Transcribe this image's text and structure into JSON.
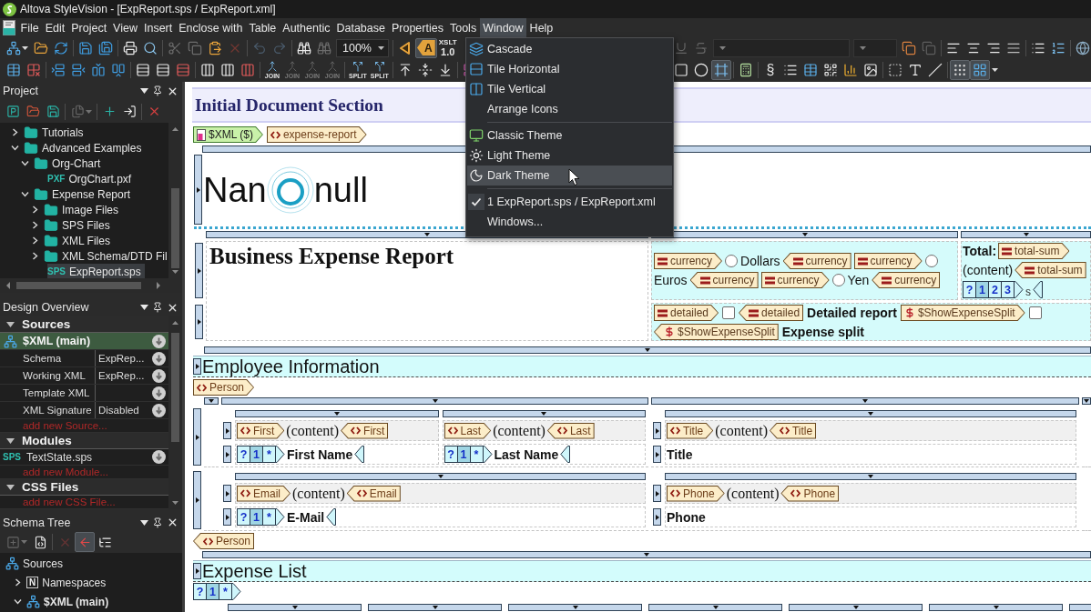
{
  "window": {
    "title": "Altova StyleVision - [ExpReport.sps / ExpReport.xml]"
  },
  "menu_bar": [
    {
      "label": "File",
      "selected": false
    },
    {
      "label": "Edit",
      "selected": false
    },
    {
      "label": "Project",
      "selected": false
    },
    {
      "label": "View",
      "selected": false
    },
    {
      "label": "Insert",
      "selected": false
    },
    {
      "label": "Enclose with",
      "selected": false
    },
    {
      "label": "Table",
      "selected": false
    },
    {
      "label": "Authentic",
      "selected": false
    },
    {
      "label": "Database",
      "selected": false
    },
    {
      "label": "Properties",
      "selected": false
    },
    {
      "label": "Tools",
      "selected": false
    },
    {
      "label": "Window",
      "selected": true
    },
    {
      "label": "Help",
      "selected": false
    }
  ],
  "toolbars": [
    {
      "left": [
        [
          {
            "kind": "dropdown",
            "disabled": false,
            "pressed": false
          },
          {
            "kind": "button",
            "disabled": false,
            "pressed": false
          },
          {
            "kind": "button",
            "disabled": false,
            "pressed": false
          }
        ],
        [
          {
            "kind": "button",
            "disabled": false,
            "pressed": false
          },
          {
            "kind": "button",
            "disabled": false,
            "pressed": false
          }
        ],
        [
          {
            "kind": "button",
            "disabled": false,
            "pressed": false
          },
          {
            "kind": "button",
            "disabled": false,
            "pressed": false
          }
        ],
        [
          {
            "kind": "button",
            "disabled": true,
            "pressed": false
          },
          {
            "kind": "button",
            "disabled": true,
            "pressed": false
          },
          {
            "kind": "button",
            "disabled": false,
            "pressed": false
          },
          {
            "kind": "button",
            "disabled": true,
            "pressed": false
          }
        ],
        [
          {
            "kind": "button",
            "disabled": true,
            "pressed": false
          },
          {
            "kind": "button",
            "disabled": true,
            "pressed": false
          }
        ],
        [
          {
            "kind": "button",
            "disabled": false,
            "pressed": false
          },
          {
            "kind": "button",
            "disabled": true,
            "pressed": false
          },
          {
            "kind": "combo",
            "value": "100%",
            "disabled": false,
            "pressed": false
          }
        ],
        [
          {
            "kind": "button",
            "disabled": false,
            "pressed": false
          },
          {
            "kind": "tag",
            "label": "A",
            "disabled": false,
            "pressed": true
          },
          {
            "kind": "stack",
            "lines": [
              "XSLT",
              "1.0"
            ],
            "disabled": false,
            "pressed": false
          }
        ]
      ],
      "right": [
        [
          {
            "kind": "button",
            "disabled": true,
            "pressed": false
          },
          {
            "kind": "button",
            "disabled": true,
            "pressed": false
          },
          {
            "kind": "combo",
            "disabled": true,
            "pressed": false
          },
          {
            "kind": "combo",
            "disabled": true,
            "pressed": false
          },
          {
            "kind": "button",
            "disabled": false,
            "pressed": false
          },
          {
            "kind": "button",
            "disabled": true,
            "pressed": false
          }
        ],
        [
          {
            "kind": "button",
            "disabled": false,
            "pressed": false
          },
          {
            "kind": "button",
            "disabled": false,
            "pressed": false
          },
          {
            "kind": "button",
            "disabled": false,
            "pressed": false
          },
          {
            "kind": "button",
            "disabled": false,
            "pressed": false
          }
        ],
        [
          {
            "kind": "button",
            "disabled": false,
            "pressed": false
          },
          {
            "kind": "button",
            "disabled": false,
            "pressed": false
          }
        ],
        [
          {
            "kind": "button",
            "disabled": false,
            "pressed": false
          }
        ]
      ]
    },
    {
      "left": [
        [
          {
            "kind": "button",
            "disabled": false,
            "pressed": false
          },
          {
            "kind": "button",
            "disabled": false,
            "pressed": false
          }
        ],
        [
          {
            "kind": "button",
            "disabled": false,
            "pressed": false
          },
          {
            "kind": "button",
            "disabled": false,
            "pressed": false
          },
          {
            "kind": "button",
            "disabled": false,
            "pressed": false
          },
          {
            "kind": "button",
            "disabled": false,
            "pressed": false
          }
        ],
        [
          {
            "kind": "button",
            "disabled": false,
            "pressed": false
          },
          {
            "kind": "button",
            "disabled": false,
            "pressed": false
          },
          {
            "kind": "button",
            "disabled": false,
            "pressed": false
          }
        ],
        [
          {
            "kind": "button",
            "disabled": false,
            "pressed": false
          },
          {
            "kind": "button",
            "disabled": false,
            "pressed": false
          },
          {
            "kind": "button",
            "disabled": false,
            "pressed": false
          }
        ],
        [
          {
            "kind": "labeled",
            "label": "JOIN",
            "disabled": false,
            "pressed": false
          },
          {
            "kind": "labeled",
            "label": "JOIN",
            "disabled": true,
            "pressed": false
          },
          {
            "kind": "labeled",
            "label": "JOIN",
            "disabled": true,
            "pressed": false
          },
          {
            "kind": "labeled",
            "label": "JOIN",
            "disabled": true,
            "pressed": false
          }
        ],
        [
          {
            "kind": "labeled",
            "label": "SPLIT",
            "disabled": false,
            "pressed": false
          },
          {
            "kind": "labeled",
            "label": "SPLIT",
            "disabled": false,
            "pressed": false
          }
        ],
        [
          {
            "kind": "button",
            "disabled": false,
            "pressed": false
          },
          {
            "kind": "button",
            "disabled": false,
            "pressed": false
          },
          {
            "kind": "button",
            "disabled": false,
            "pressed": false
          }
        ],
        [
          {
            "kind": "button",
            "disabled": false,
            "pressed": false
          }
        ]
      ],
      "right": [
        [
          {
            "kind": "button",
            "disabled": false,
            "pressed": false
          },
          {
            "kind": "button",
            "disabled": false,
            "pressed": false
          },
          {
            "kind": "button",
            "disabled": false,
            "pressed": true
          }
        ],
        [
          {
            "kind": "button",
            "disabled": false,
            "pressed": false
          }
        ],
        [
          {
            "kind": "glyph",
            "label": "§",
            "disabled": false,
            "pressed": false
          },
          {
            "kind": "button",
            "disabled": false,
            "pressed": false
          },
          {
            "kind": "button",
            "disabled": false,
            "pressed": false
          },
          {
            "kind": "button",
            "disabled": false,
            "pressed": false
          },
          {
            "kind": "button",
            "disabled": false,
            "pressed": false
          },
          {
            "kind": "button",
            "disabled": false,
            "pressed": false
          }
        ],
        [
          {
            "kind": "button",
            "disabled": false,
            "pressed": false
          },
          {
            "kind": "button",
            "disabled": false,
            "pressed": false
          },
          {
            "kind": "button",
            "disabled": false,
            "pressed": false
          }
        ],
        [
          {
            "kind": "button",
            "disabled": false,
            "pressed": true
          },
          {
            "kind": "button",
            "disabled": false,
            "pressed": true
          },
          {
            "kind": "more",
            "disabled": false,
            "pressed": false
          }
        ]
      ]
    }
  ],
  "window_menu": {
    "groups": [
      [
        {
          "label": "Cascade",
          "selected": false,
          "checked": false
        },
        {
          "label": "Tile Horizontal",
          "selected": false,
          "checked": false
        },
        {
          "label": "Tile Vertical",
          "selected": false,
          "checked": false
        },
        {
          "label": "Arrange Icons",
          "selected": false,
          "checked": false
        }
      ],
      [
        {
          "label": "Classic Theme",
          "selected": false,
          "checked": false
        },
        {
          "label": "Light Theme",
          "selected": false,
          "checked": false
        },
        {
          "label": "Dark Theme",
          "selected": true,
          "checked": false
        }
      ],
      [
        {
          "label": "1 ExpReport.sps / ExpReport.xml",
          "selected": false,
          "checked": true
        },
        {
          "label": "Windows...",
          "selected": false,
          "checked": false
        }
      ]
    ]
  },
  "project": {
    "title": "Project",
    "toolbar": [
      [
        {
          "kind": "button",
          "disabled": false,
          "pressed": false
        },
        {
          "kind": "button",
          "disabled": false,
          "pressed": false
        },
        {
          "kind": "button",
          "disabled": false,
          "pressed": false
        }
      ],
      [
        {
          "kind": "dropdown",
          "disabled": true,
          "pressed": false
        }
      ],
      [
        {
          "kind": "button",
          "disabled": false,
          "pressed": false
        },
        {
          "kind": "button",
          "disabled": false,
          "pressed": false
        }
      ],
      [
        {
          "kind": "button",
          "disabled": false,
          "pressed": false
        }
      ]
    ],
    "tree": [
      {
        "kind": "folder",
        "label": "Tutorials",
        "expanded": false,
        "selected": false
      },
      {
        "kind": "folder",
        "label": "Advanced Examples",
        "expanded": true,
        "selected": false,
        "children": [
          {
            "kind": "folder",
            "label": "Org-Chart",
            "expanded": true,
            "selected": false,
            "children": [
              {
                "kind": "file",
                "badge": "PXF",
                "label": "OrgChart.pxf",
                "selected": false
              }
            ]
          },
          {
            "kind": "folder",
            "label": "Expense Report",
            "expanded": true,
            "selected": false,
            "children": [
              {
                "kind": "folder",
                "label": "Image Files",
                "expanded": false,
                "selected": false
              },
              {
                "kind": "folder",
                "label": "SPS Files",
                "expanded": false,
                "selected": false
              },
              {
                "kind": "folder",
                "label": "XML Files",
                "expanded": false,
                "selected": false
              },
              {
                "kind": "folder",
                "label": "XML Schema/DTD Fil",
                "expanded": false,
                "selected": false
              },
              {
                "kind": "file",
                "badge": "SPS",
                "label": "ExpReport.sps",
                "selected": true
              }
            ]
          }
        ]
      }
    ]
  },
  "design_overview": {
    "title": "Design Overview",
    "sections": [
      {
        "title": "Sources",
        "expanded": true,
        "items": [
          {
            "kind": "source",
            "label": "$XML (main)",
            "selected": true
          },
          {
            "kind": "property",
            "label": "Schema",
            "value": "ExpRep...",
            "selected": false
          },
          {
            "kind": "property",
            "label": "Working XML",
            "value": "ExpRep...",
            "selected": false
          },
          {
            "kind": "property",
            "label": "Template XML",
            "selected": false
          },
          {
            "kind": "property",
            "label": "XML Signature",
            "value": "Disabled",
            "selected": false
          },
          {
            "kind": "add",
            "label": "add new Source...",
            "selected": false
          }
        ]
      },
      {
        "title": "Modules",
        "expanded": true,
        "items": [
          {
            "kind": "module",
            "badge": "SPS",
            "label": "TextState.sps",
            "selected": false
          },
          {
            "kind": "add",
            "label": "add new Module...",
            "selected": false
          }
        ]
      },
      {
        "title": "CSS Files",
        "expanded": true,
        "items": [
          {
            "kind": "add",
            "label": "add new CSS File...",
            "selected": false
          }
        ]
      }
    ]
  },
  "schema_tree": {
    "title": "Schema Tree",
    "toolbar": [
      [
        {
          "kind": "dropdown",
          "disabled": true,
          "pressed": false
        },
        {
          "kind": "button",
          "disabled": false,
          "pressed": false
        }
      ],
      [
        {
          "kind": "button",
          "disabled": true,
          "pressed": false
        },
        {
          "kind": "button",
          "disabled": false,
          "pressed": true
        },
        {
          "kind": "button",
          "disabled": false,
          "pressed": false
        }
      ]
    ],
    "tree": [
      {
        "kind": "root",
        "label": "Sources",
        "children": [
          {
            "kind": "namespaces",
            "badge": "N",
            "label": "Namespaces",
            "expanded": false
          },
          {
            "kind": "source",
            "label": "$XML (main)",
            "expanded": true
          }
        ]
      }
    ]
  },
  "design": {
    "section_title": "Initial Document Section",
    "root_tags": [
      {
        "kind": "source",
        "closing": false,
        "text": "$XML ($)"
      },
      {
        "kind": "element",
        "closing": false,
        "text": "expense-report"
      }
    ],
    "logo": {
      "left": "Nan",
      "right": "null"
    },
    "header_table": {
      "title": "Business Expense Report",
      "currency": {
        "lines": [
          [
            {
              "kind": "field",
              "closing": false,
              "text": "currency"
            },
            {
              "kind": "radio",
              "checked": false
            },
            {
              "kind": "text",
              "text": "Dollars"
            },
            {
              "kind": "field",
              "closing": true,
              "text": "currency"
            },
            {
              "kind": "field",
              "closing": false,
              "text": "currency"
            },
            {
              "kind": "radio",
              "checked": false
            }
          ],
          [
            {
              "kind": "text",
              "text": "Euros"
            },
            {
              "kind": "field",
              "closing": true,
              "text": "currency"
            },
            {
              "kind": "field",
              "closing": false,
              "text": "currency"
            },
            {
              "kind": "radio",
              "checked": false
            },
            {
              "kind": "text",
              "text": "Yen"
            },
            {
              "kind": "field",
              "closing": true,
              "text": "currency"
            }
          ]
        ]
      },
      "total": {
        "lines": [
          [
            {
              "kind": "label",
              "text": "Total:"
            },
            {
              "kind": "field",
              "closing": false,
              "text": "total-sum"
            }
          ],
          [
            {
              "kind": "text",
              "text": "(content)"
            },
            {
              "kind": "field",
              "closing": true,
              "text": "total-sum"
            }
          ],
          [
            {
              "kind": "condition",
              "cells": [
                {
                  "text": "?",
                  "selected": false
                },
                {
                  "text": "1",
                  "selected": true
                },
                {
                  "text": "2",
                  "selected": false
                },
                {
                  "text": "3",
                  "selected": false
                }
              ]
            },
            {
              "kind": "note",
              "text": "s"
            },
            {
              "kind": "condition-end"
            }
          ]
        ]
      },
      "options": {
        "lines": [
          [
            {
              "kind": "field",
              "closing": false,
              "text": "detailed"
            },
            {
              "kind": "checkbox",
              "checked": false
            },
            {
              "kind": "field",
              "closing": true,
              "text": "detailed"
            },
            {
              "kind": "label",
              "text": "Detailed report"
            },
            {
              "kind": "param",
              "closing": false,
              "text": "$ShowExpenseSplit"
            },
            {
              "kind": "checkbox",
              "checked": false
            }
          ],
          [
            {
              "kind": "param",
              "closing": true,
              "text": "$ShowExpenseSplit"
            },
            {
              "kind": "label",
              "text": "Expense split"
            }
          ]
        ]
      }
    },
    "employee": {
      "title": "Employee Information",
      "open_tag": {
        "kind": "element",
        "closing": false,
        "text": "Person"
      },
      "rows": [
        {
          "left": {
            "rows": [
              {
                "cells": [
                  {
                    "items": [
                      {
                        "kind": "element",
                        "closing": false,
                        "text": "First"
                      },
                      {
                        "kind": "content",
                        "text": "(content)"
                      },
                      {
                        "kind": "element",
                        "closing": true,
                        "text": "First"
                      }
                    ]
                  },
                  {
                    "items": [
                      {
                        "kind": "element",
                        "closing": false,
                        "text": "Last"
                      },
                      {
                        "kind": "content",
                        "text": "(content)"
                      },
                      {
                        "kind": "element",
                        "closing": true,
                        "text": "Last"
                      }
                    ]
                  }
                ]
              },
              {
                "cells": [
                  {
                    "items": [
                      {
                        "kind": "condition",
                        "cells": [
                          {
                            "text": "?",
                            "selected": false
                          },
                          {
                            "text": "1",
                            "selected": true
                          },
                          {
                            "text": "*",
                            "selected": false
                          }
                        ]
                      },
                      {
                        "kind": "label",
                        "text": "First Name"
                      },
                      {
                        "kind": "condition-end"
                      }
                    ]
                  },
                  {
                    "items": [
                      {
                        "kind": "condition",
                        "cells": [
                          {
                            "text": "?",
                            "selected": false
                          },
                          {
                            "text": "1",
                            "selected": true
                          },
                          {
                            "text": "*",
                            "selected": false
                          }
                        ]
                      },
                      {
                        "kind": "label",
                        "text": "Last Name"
                      },
                      {
                        "kind": "condition-end"
                      }
                    ]
                  }
                ]
              }
            ]
          },
          "right": {
            "rows": [
              {
                "cells": [
                  {
                    "items": [
                      {
                        "kind": "element",
                        "closing": false,
                        "text": "Title"
                      },
                      {
                        "kind": "content",
                        "text": "(content)"
                      },
                      {
                        "kind": "element",
                        "closing": true,
                        "text": "Title"
                      }
                    ]
                  }
                ]
              },
              {
                "cells": [
                  {
                    "items": [
                      {
                        "kind": "label",
                        "text": "Title"
                      }
                    ]
                  }
                ]
              }
            ]
          }
        },
        {
          "left": {
            "rows": [
              {
                "cells": [
                  {
                    "items": [
                      {
                        "kind": "element",
                        "closing": false,
                        "text": "Email"
                      },
                      {
                        "kind": "content",
                        "text": "(content)"
                      },
                      {
                        "kind": "element",
                        "closing": true,
                        "text": "Email"
                      }
                    ]
                  }
                ]
              },
              {
                "cells": [
                  {
                    "items": [
                      {
                        "kind": "condition",
                        "cells": [
                          {
                            "text": "?",
                            "selected": false
                          },
                          {
                            "text": "1",
                            "selected": true
                          },
                          {
                            "text": "*",
                            "selected": false
                          }
                        ]
                      },
                      {
                        "kind": "label",
                        "text": "E-Mail"
                      },
                      {
                        "kind": "condition-end"
                      }
                    ]
                  }
                ]
              }
            ]
          },
          "right": {
            "rows": [
              {
                "cells": [
                  {
                    "items": [
                      {
                        "kind": "element",
                        "closing": false,
                        "text": "Phone"
                      },
                      {
                        "kind": "content",
                        "text": "(content)"
                      },
                      {
                        "kind": "element",
                        "closing": true,
                        "text": "Phone"
                      }
                    ]
                  }
                ]
              },
              {
                "cells": [
                  {
                    "items": [
                      {
                        "kind": "label",
                        "text": "Phone"
                      }
                    ]
                  }
                ]
              }
            ]
          }
        }
      ],
      "close_tag": {
        "kind": "element",
        "closing": true,
        "text": "Person"
      }
    },
    "expense_list": {
      "title": "Expense List",
      "condition": {
        "kind": "condition",
        "cells": [
          {
            "text": "?",
            "selected": false
          },
          {
            "text": "1",
            "selected": true
          },
          {
            "text": "*",
            "selected": false
          }
        ]
      }
    }
  }
}
